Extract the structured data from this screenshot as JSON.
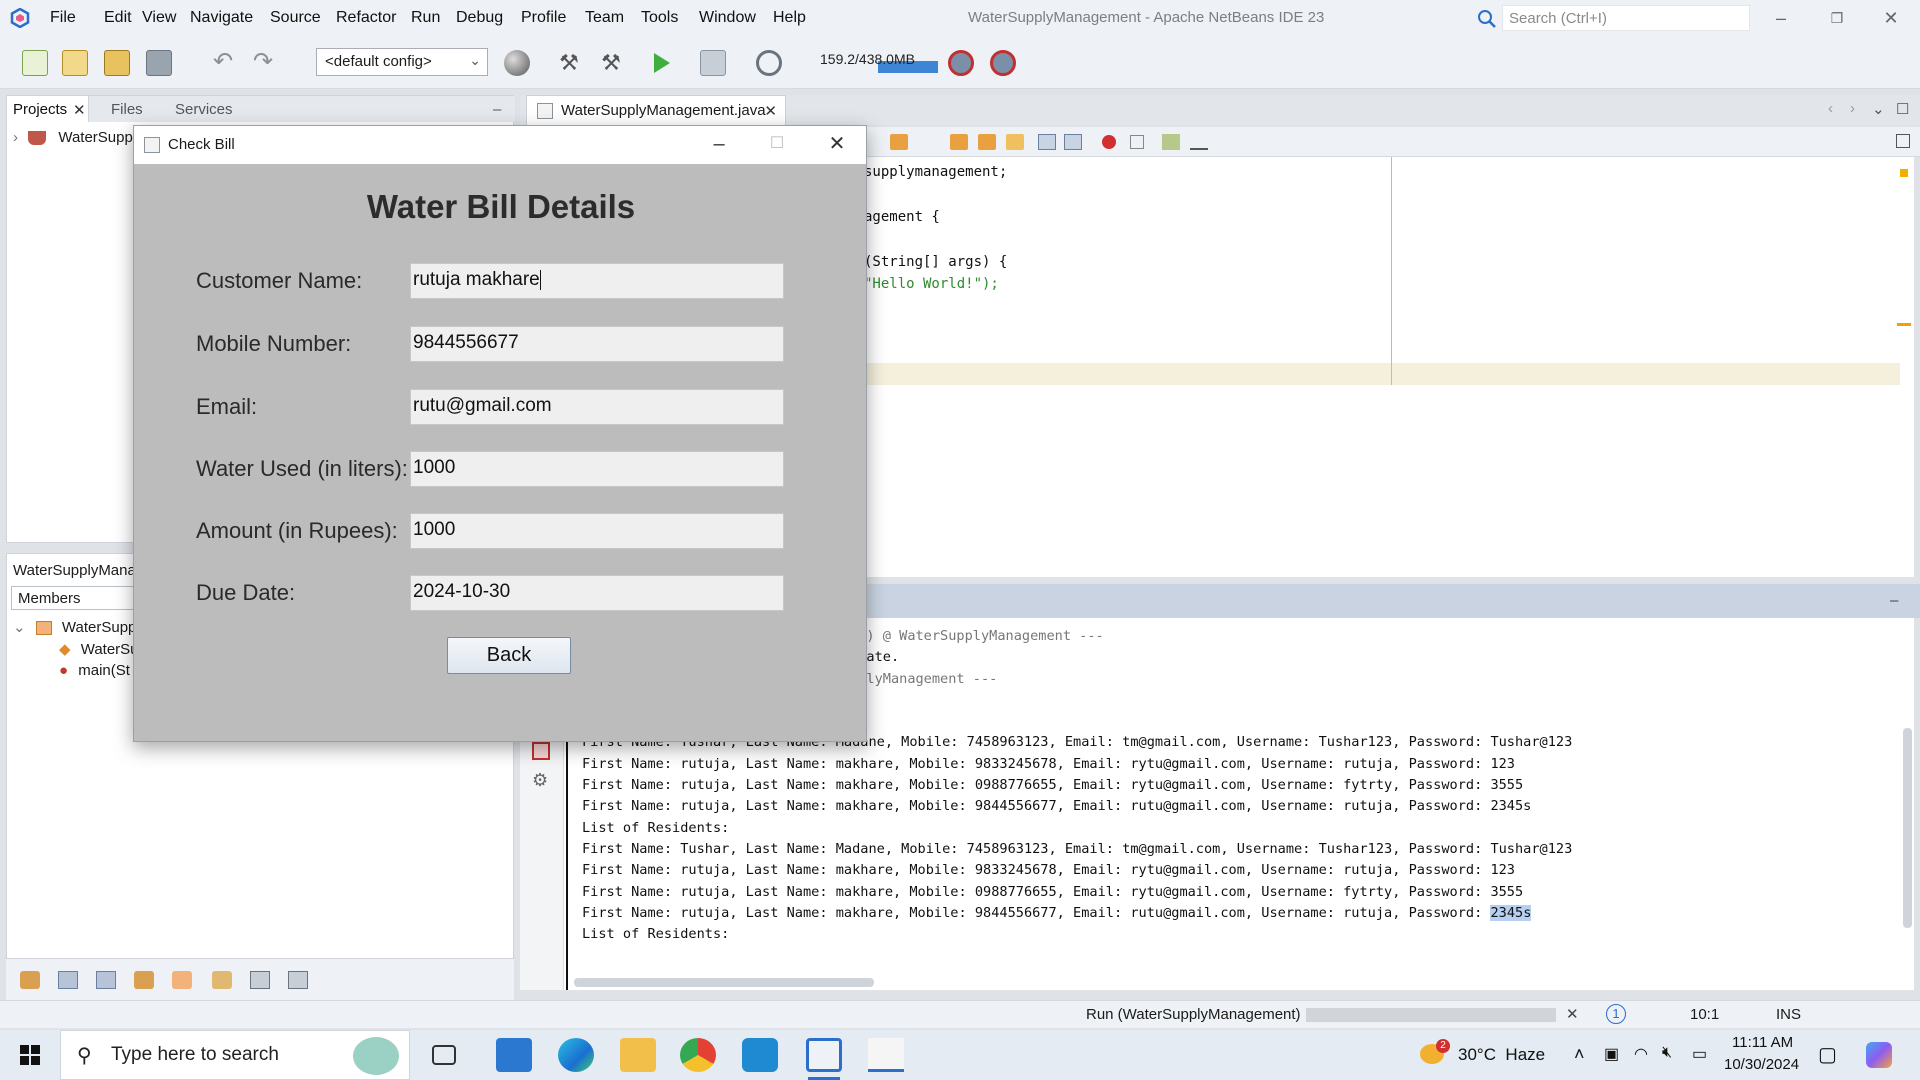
{
  "app": {
    "window_title": "WaterSupplyManagement - Apache NetBeans IDE 23",
    "menu": [
      "File",
      "Edit",
      "View",
      "Navigate",
      "Source",
      "Refactor",
      "Run",
      "Debug",
      "Profile",
      "Team",
      "Tools",
      "Window",
      "Help"
    ],
    "search_placeholder": "Search (Ctrl+I)"
  },
  "toolbar": {
    "config": "<default config>",
    "memory": "159.2/438.0MB"
  },
  "left_panel": {
    "tabs": [
      "Projects",
      "Files",
      "Services"
    ],
    "project_node": "WaterSupp",
    "navigator_title": "WaterSupplyMana",
    "members_label": "Members",
    "tree": [
      "WaterSupp",
      "WaterSu",
      "main(St"
    ]
  },
  "editor": {
    "tab": "WaterSupplyManagement.java",
    "lines": [
      "supplymanagement;",
      "agement {",
      "(String[] args) {",
      "\"Hello World!\");"
    ]
  },
  "output": {
    "lines": [
      {
        "text": "fault-compile) @ WaterSupplyManagement ---",
        "grey": true
      },
      {
        "text": "s are up to date.",
        "grey": false
      },
      {
        "text": "",
        "grey": false
      },
      {
        "text": ") @ WaterSupplyManagement ---",
        "grey": true
      },
      {
        "text": "Hello World!",
        "grey": false
      },
      {
        "text": "List of Residents:",
        "grey": false
      },
      {
        "text": "First Name: Tushar, Last Name: Madane, Mobile: 7458963123, Email: tm@gmail.com, Username: Tushar123, Password: Tushar@123",
        "grey": false
      },
      {
        "text": "First Name: rutuja, Last Name: makhare, Mobile: 9833245678, Email: rytu@gmail.com, Username: rutuja, Password: 123",
        "grey": false
      },
      {
        "text": "First Name: rutuja, Last Name: makhare, Mobile: 0988776655, Email: rytu@gmail.com, Username: fytrty, Password: 3555",
        "grey": false
      },
      {
        "text": "First Name: rutuja, Last Name: makhare, Mobile: 9844556677, Email: rutu@gmail.com, Username: rutuja, Password: 2345s",
        "grey": false
      },
      {
        "text": "List of Residents:",
        "grey": false
      },
      {
        "text": "First Name: Tushar, Last Name: Madane, Mobile: 7458963123, Email: tm@gmail.com, Username: Tushar123, Password: Tushar@123",
        "grey": false
      },
      {
        "text": "First Name: rutuja, Last Name: makhare, Mobile: 9833245678, Email: rytu@gmail.com, Username: rutuja, Password: 123",
        "grey": false
      },
      {
        "text": "First Name: rutuja, Last Name: makhare, Mobile: 0988776655, Email: rytu@gmail.com, Username: fytrty, Password: 3555",
        "grey": false
      },
      {
        "text": "First Name: rutuja, Last Name: makhare, Mobile: 9844556677, Email: rutu@gmail.com, Username: rutuja, Password: ",
        "grey": false,
        "selected": "2345s"
      },
      {
        "text": "List of Residents:",
        "grey": false
      }
    ]
  },
  "status": {
    "task": "Run (WaterSupplyManagement)",
    "notifications": "1",
    "position": "10:1",
    "mode": "INS"
  },
  "dialog": {
    "title": "Check Bill",
    "heading": "Water Bill Details",
    "fields": [
      {
        "label": "Customer Name:",
        "value": "rutuja makhare"
      },
      {
        "label": "Mobile Number:",
        "value": "9844556677"
      },
      {
        "label": "Email:",
        "value": "rutu@gmail.com"
      },
      {
        "label": "Water Used (in liters):",
        "value": "1000"
      },
      {
        "label": "Amount (in Rupees):",
        "value": "1000"
      },
      {
        "label": "Due Date:",
        "value": "2024-10-30"
      }
    ],
    "back_label": "Back"
  },
  "taskbar": {
    "search_placeholder": "Type here to search",
    "weather": "30°C  Haze",
    "weather_badge": "2",
    "time": "11:11 AM",
    "date": "10/30/2024"
  },
  "colors": {
    "accent_blue": "#3e86d5",
    "dialog_bg": "#bcbcbc",
    "selection": "#b7cff0"
  }
}
